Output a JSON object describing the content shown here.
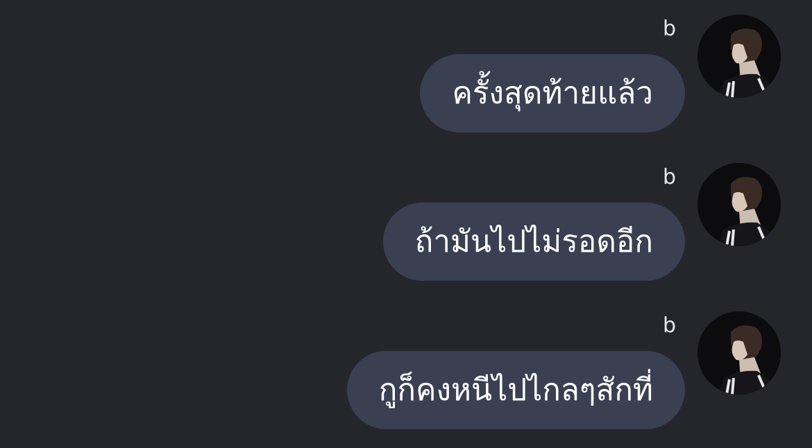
{
  "messages": [
    {
      "sender": "b",
      "text": "ครั้งสุดท้ายแล้ว",
      "avatar_icon": "profile-photo"
    },
    {
      "sender": "b",
      "text": "ถ้ามันไปไม่รอดอีก",
      "avatar_icon": "profile-photo"
    },
    {
      "sender": "b",
      "text": "กูก็คงหนีไปไกลๆสักที่",
      "avatar_icon": "profile-photo"
    }
  ],
  "colors": {
    "background": "#25252c",
    "bubble": "#3a4051",
    "text": "#ffffff"
  }
}
